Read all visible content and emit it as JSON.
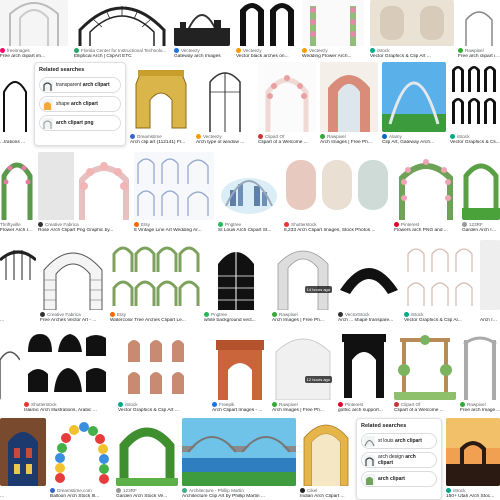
{
  "tiles": [
    {
      "source": "freeimages",
      "title": "Free arch clipart im...",
      "color": "#f06"
    },
    {
      "source": "Florida Center for Instructional Technolo...",
      "title": "Elliptical Arch | ClipArt ETC",
      "color": "#2a6"
    },
    {
      "source": "Vecteezy",
      "title": "Gateway arch Images",
      "color": "#1a73e8"
    },
    {
      "source": "Vecteezy",
      "title": "Vector black arches on...",
      "color": "#f90"
    },
    {
      "source": "Vecteezy",
      "title": "Wedding Flower Arch...",
      "color": "#f90"
    },
    {
      "source": "iStock",
      "title": "Vector Graphics & Clip Art ...",
      "color": "#0a8"
    },
    {
      "source": "Rawpixel",
      "title": "Free arch clipart illu...",
      "color": "#3a3"
    },
    {
      "source": "",
      "title": "...trations ...",
      "color": "#888"
    },
    {
      "source": "Dreamstime",
      "title": "Arch clip art (112141) Fr...",
      "color": "#36c"
    },
    {
      "source": "Vecteezy",
      "title": "Arch type of window ...",
      "color": "#f90"
    },
    {
      "source": "Clipart Of",
      "title": "Clipart of a Welcome ...",
      "color": "#c33"
    },
    {
      "source": "Rawpixel",
      "title": "Arch Images | Free Ph...",
      "color": "#3a3"
    },
    {
      "source": "Alamy",
      "title": "Clip Art, Gateway Arch...",
      "color": "#06c"
    },
    {
      "source": "iStock",
      "title": "Vector Graphics & Cli...",
      "color": "#0a8"
    },
    {
      "source": "Thriftyville",
      "title": "Flower Arch Ima...",
      "color": "#c6a"
    },
    {
      "source": "Creative Fabrica",
      "title": "Rose Arch Clipart Png Graphic by...",
      "color": "#333"
    },
    {
      "source": "Etsy",
      "title": "8 Vintage Line Art Wedding Ar...",
      "color": "#f60"
    },
    {
      "source": "Pngtree",
      "title": "St Louis Arch Clipart St...",
      "color": "#2b5"
    },
    {
      "source": "Shutterstock",
      "title": "8,233 Arch Clipart Images, Stock Photos ...",
      "color": "#e33"
    },
    {
      "source": "Pinterest",
      "title": "Flowers arch PNG and ...",
      "color": "#e60023"
    },
    {
      "source": "123RF",
      "title": "Garden Arch Ima...",
      "color": "#999"
    },
    {
      "source": "Creative Fabrica",
      "title": "Free Arches Vector Art - ...",
      "color": "#333"
    },
    {
      "source": "Etsy",
      "title": "Watercolor Tree Arches Clipart Le...",
      "color": "#f60"
    },
    {
      "source": "Pngtree",
      "title": "white background vect...",
      "color": "#2b5"
    },
    {
      "source": "Rawpixel",
      "title": "Arch Images | Free Ph...",
      "color": "#3a3"
    },
    {
      "source": "VectorStock",
      "title": "Arch ... shape transpare...",
      "color": "#333"
    },
    {
      "source": "iStock",
      "title": "Vector Graphics & Clip Ar...",
      "color": "#0a8"
    },
    {
      "source": "",
      "title": "Arch Images ...",
      "color": "#888"
    },
    {
      "source": "",
      "title": "...",
      "color": "#888"
    },
    {
      "source": "Shutterstock",
      "title": "Islamic Arch Illustrations, Arabic ...",
      "color": "#e33"
    },
    {
      "source": "iStock",
      "title": "Vector Graphics & Clip Art ...",
      "color": "#0a8"
    },
    {
      "source": "Freepik",
      "title": "Arch Clipart Images - ...",
      "color": "#1273eb"
    },
    {
      "source": "Rawpixel",
      "title": "Arch Images | Free Ph...",
      "color": "#3a3"
    },
    {
      "source": "Pinterest",
      "title": "gothic arch support...",
      "color": "#e60023"
    },
    {
      "source": "Clipart Of",
      "title": "Clipart of a Welcome ...",
      "color": "#c33"
    },
    {
      "source": "Rawpixel",
      "title": "Free arch Images | ...",
      "color": "#3a3"
    },
    {
      "source": "",
      "title": "...",
      "color": "#888"
    },
    {
      "source": "Dreamstime.com",
      "title": "Balloon Arch Stock Ill...",
      "color": "#36c"
    },
    {
      "source": "123RF",
      "title": "Garden Arch Stock Ve...",
      "color": "#999"
    },
    {
      "source": "Architecture - Phillip Martin",
      "title": "Architecture Clip Art by Phillip Martin ...",
      "color": "#4a8"
    },
    {
      "source": "Cikel",
      "title": "Indian Arch Clipart ...",
      "color": "#222"
    },
    {
      "source": "iStock",
      "title": "150+ Utah Arch Stoc...",
      "color": "#0a8"
    }
  ],
  "badges": {
    "b1": "14 hours ago",
    "b2": "12 hours ago"
  },
  "related_top": {
    "title": "Related searches",
    "items": [
      {
        "pre": "transparent ",
        "bold": "arch clipart"
      },
      {
        "pre": "shape ",
        "bold": "arch clipart"
      },
      {
        "pre": "",
        "bold": "arch clipart png"
      }
    ]
  },
  "related_bottom": {
    "title": "Related searches",
    "items": [
      {
        "pre": "st louis ",
        "bold": "arch clipart"
      },
      {
        "pre": "arch design ",
        "bold": "arch clipart"
      },
      {
        "pre": "",
        "bold": "arch clipart"
      }
    ]
  }
}
